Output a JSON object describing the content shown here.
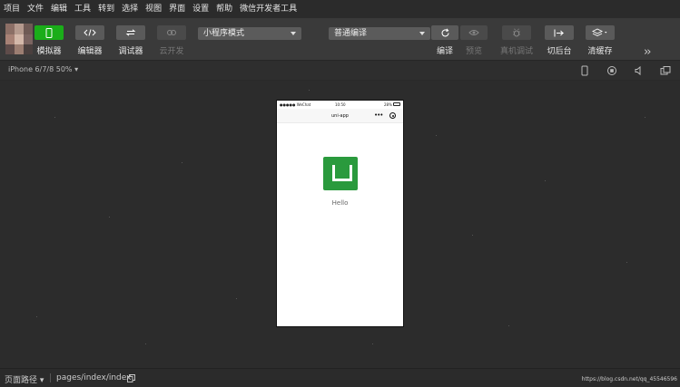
{
  "menu": [
    "项目",
    "文件",
    "编辑",
    "工具",
    "转到",
    "选择",
    "视图",
    "界面",
    "设置",
    "帮助",
    "微信开发者工具"
  ],
  "toolbar": {
    "simulator": "模拟器",
    "editor": "编辑器",
    "debugger": "调试器",
    "cloud": "云开发",
    "mode_select": "小程序模式",
    "compile_select": "普通编译",
    "compile": "编译",
    "preview": "预览",
    "remote_debug": "真机调试",
    "background": "切后台",
    "clear_cache": "清缓存"
  },
  "device": {
    "selector": "iPhone 6/7/8 50% ▾"
  },
  "phone": {
    "carrier": "●●●●● WeChat",
    "time": "10:50",
    "battery": "28%",
    "nav_title": "uni-app",
    "hello": "Hello"
  },
  "statusbar": {
    "path_label": "页面路径 ▾",
    "page": "pages/index/index",
    "url": "https://blog.csdn.net/qq_45546596"
  },
  "colors": {
    "accent": "#1aad19",
    "logo": "#2a9a3d"
  }
}
